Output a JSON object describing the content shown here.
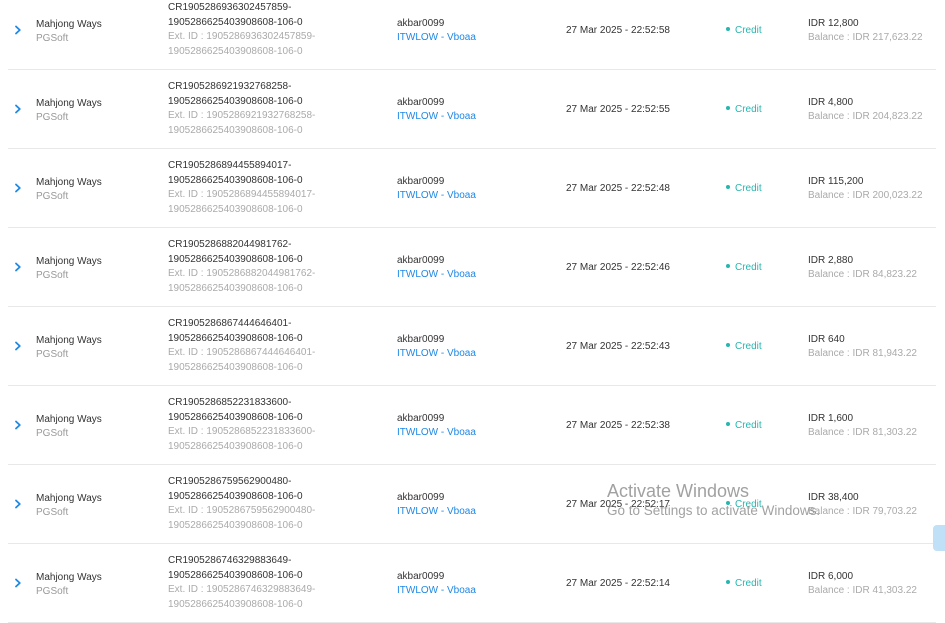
{
  "rows": [
    {
      "game": "Mahjong Ways",
      "provider": "PGSoft",
      "txn_line1": "CR1905286936302457859-",
      "txn_line2": "1905286625403908608-106-0",
      "ext_line1": "Ext. ID : 1905286936302457859-",
      "ext_line2": "1905286625403908608-106-0",
      "user": "akbar0099",
      "site": "ITWLOW - Vboaa",
      "date": "27 Mar 2025 - 22:52:58",
      "type": "Credit",
      "amount": "IDR 12,800",
      "balance": "Balance : IDR 217,623.22"
    },
    {
      "game": "Mahjong Ways",
      "provider": "PGSoft",
      "txn_line1": "CR1905286921932768258-",
      "txn_line2": "1905286625403908608-106-0",
      "ext_line1": "Ext. ID : 1905286921932768258-",
      "ext_line2": "1905286625403908608-106-0",
      "user": "akbar0099",
      "site": "ITWLOW - Vboaa",
      "date": "27 Mar 2025 - 22:52:55",
      "type": "Credit",
      "amount": "IDR 4,800",
      "balance": "Balance : IDR 204,823.22"
    },
    {
      "game": "Mahjong Ways",
      "provider": "PGSoft",
      "txn_line1": "CR1905286894455894017-",
      "txn_line2": "1905286625403908608-106-0",
      "ext_line1": "Ext. ID : 1905286894455894017-",
      "ext_line2": "1905286625403908608-106-0",
      "user": "akbar0099",
      "site": "ITWLOW - Vboaa",
      "date": "27 Mar 2025 - 22:52:48",
      "type": "Credit",
      "amount": "IDR 115,200",
      "balance": "Balance : IDR 200,023.22"
    },
    {
      "game": "Mahjong Ways",
      "provider": "PGSoft",
      "txn_line1": "CR1905286882044981762-",
      "txn_line2": "1905286625403908608-106-0",
      "ext_line1": "Ext. ID : 1905286882044981762-",
      "ext_line2": "1905286625403908608-106-0",
      "user": "akbar0099",
      "site": "ITWLOW - Vboaa",
      "date": "27 Mar 2025 - 22:52:46",
      "type": "Credit",
      "amount": "IDR 2,880",
      "balance": "Balance : IDR 84,823.22"
    },
    {
      "game": "Mahjong Ways",
      "provider": "PGSoft",
      "txn_line1": "CR1905286867444646401-",
      "txn_line2": "1905286625403908608-106-0",
      "ext_line1": "Ext. ID : 1905286867444646401-",
      "ext_line2": "1905286625403908608-106-0",
      "user": "akbar0099",
      "site": "ITWLOW - Vboaa",
      "date": "27 Mar 2025 - 22:52:43",
      "type": "Credit",
      "amount": "IDR 640",
      "balance": "Balance : IDR 81,943.22"
    },
    {
      "game": "Mahjong Ways",
      "provider": "PGSoft",
      "txn_line1": "CR1905286852231833600-",
      "txn_line2": "1905286625403908608-106-0",
      "ext_line1": "Ext. ID : 1905286852231833600-",
      "ext_line2": "1905286625403908608-106-0",
      "user": "akbar0099",
      "site": "ITWLOW - Vboaa",
      "date": "27 Mar 2025 - 22:52:38",
      "type": "Credit",
      "amount": "IDR 1,600",
      "balance": "Balance : IDR 81,303.22"
    },
    {
      "game": "Mahjong Ways",
      "provider": "PGSoft",
      "txn_line1": "CR1905286759562900480-",
      "txn_line2": "1905286625403908608-106-0",
      "ext_line1": "Ext. ID : 1905286759562900480-",
      "ext_line2": "1905286625403908608-106-0",
      "user": "akbar0099",
      "site": "ITWLOW - Vboaa",
      "date": "27 Mar 2025 - 22:52:17",
      "type": "Credit",
      "amount": "IDR 38,400",
      "balance": "Balance : IDR 79,703.22"
    },
    {
      "game": "Mahjong Ways",
      "provider": "PGSoft",
      "txn_line1": "CR1905286746329883649-",
      "txn_line2": "1905286625403908608-106-0",
      "ext_line1": "Ext. ID : 1905286746329883649-",
      "ext_line2": "1905286625403908608-106-0",
      "user": "akbar0099",
      "site": "ITWLOW - Vboaa",
      "date": "27 Mar 2025 - 22:52:14",
      "type": "Credit",
      "amount": "IDR 6,000",
      "balance": "Balance : IDR 41,303.22"
    }
  ],
  "watermark": {
    "title": "Activate Windows",
    "subtitle": "Go to Settings to activate Windows."
  },
  "icons": {
    "expand": "chevron-right-icon"
  },
  "colors": {
    "link": "#1e88e5",
    "credit": "#26b6b0",
    "muted": "#aaaaaa",
    "divider": "#e8e8e8"
  }
}
